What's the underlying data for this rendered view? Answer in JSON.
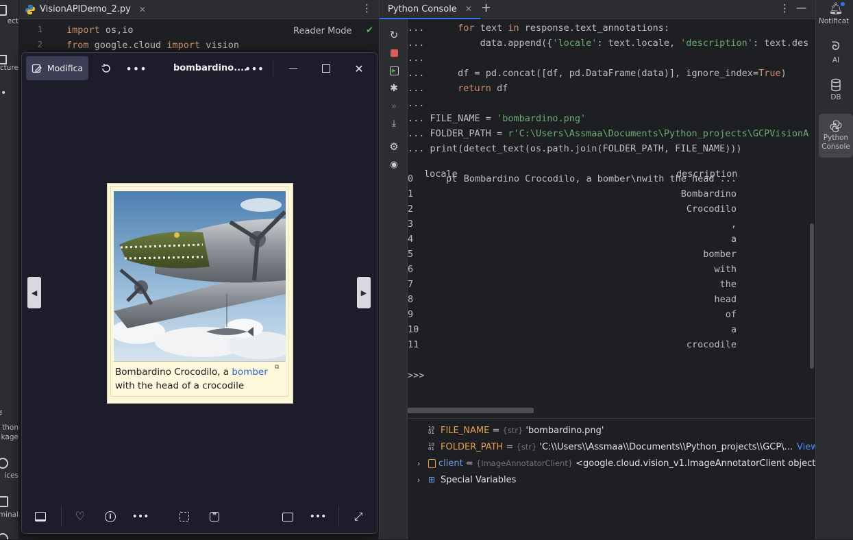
{
  "left_strip": {
    "labels": [
      "ect",
      "cture",
      "thon\nkage",
      "ices",
      "minal"
    ]
  },
  "editor": {
    "file_name": "VisionAPIDemo_2.py",
    "reader_mode": "Reader Mode",
    "lines": [
      {
        "num": "1",
        "kw1": "import",
        "rest": " os,io"
      },
      {
        "num": "2",
        "kw1": "from",
        "mid": " google.cloud ",
        "kw2": "import",
        "rest": " vision"
      }
    ]
  },
  "viewer": {
    "edit_label": "Modifica",
    "title": "bombardino....",
    "caption_text": "Bombardino Crocodilo, a ",
    "caption_link": "bomber",
    "caption_line2": "with the head of a crocodile",
    "accent": "#5b5fc7"
  },
  "console": {
    "tab_label": "Python Console",
    "lines": [
      {
        "prefix": "...",
        "code": "      for text in response.text_annotations:"
      },
      {
        "prefix": "...",
        "code": "          data.append({'locale': text.locale, 'description': text.descrip"
      },
      {
        "prefix": "...",
        "code": ""
      },
      {
        "prefix": "...",
        "code": "      df = pd.concat([df, pd.DataFrame(data)], ignore_index=True)"
      },
      {
        "prefix": "...",
        "code": "      return df"
      },
      {
        "prefix": "...",
        "code": ""
      },
      {
        "prefix": "...",
        "code": " FILE_NAME = 'bombardino.png'"
      },
      {
        "prefix": "...",
        "code": " FOLDER_PATH = r'C:\\Users\\Assmaa\\Documents\\Python_projects\\GCPVisionAPID"
      },
      {
        "prefix": "...",
        "code": " print(detect_text(os.path.join(FOLDER_PATH, FILE_NAME)))"
      }
    ],
    "table_header": {
      "locale": "locale",
      "description": "description"
    },
    "table_rows": [
      {
        "idx": "0",
        "locale": "pt",
        "description": "Bombardino Crocodilo, a bomber\\nwith the head ..."
      },
      {
        "idx": "1",
        "locale": "",
        "description": "Bombardino"
      },
      {
        "idx": "2",
        "locale": "",
        "description": "Crocodilo"
      },
      {
        "idx": "3",
        "locale": "",
        "description": ","
      },
      {
        "idx": "4",
        "locale": "",
        "description": "a"
      },
      {
        "idx": "5",
        "locale": "",
        "description": "bomber"
      },
      {
        "idx": "6",
        "locale": "",
        "description": "with"
      },
      {
        "idx": "7",
        "locale": "",
        "description": "the"
      },
      {
        "idx": "8",
        "locale": "",
        "description": "head"
      },
      {
        "idx": "9",
        "locale": "",
        "description": "of"
      },
      {
        "idx": "10",
        "locale": "",
        "description": "a"
      },
      {
        "idx": "11",
        "locale": "",
        "description": "crocodile"
      }
    ],
    "prompt": ">>>"
  },
  "variables": [
    {
      "icon": "string-var-icon",
      "name": "FILE_NAME",
      "type": "{str}",
      "value": "'bombardino.png'",
      "expandable": false
    },
    {
      "icon": "string-var-icon",
      "name": "FOLDER_PATH",
      "type": "{str}",
      "value": "'C:\\\\Users\\\\Assmaa\\\\Documents\\\\Python_projects\\\\GCP\\...",
      "link": "View",
      "expandable": false
    },
    {
      "icon": "object-var-icon",
      "name": "client",
      "type": "{ImageAnnotatorClient}",
      "value": "<google.cloud.vision_v1.ImageAnnotatorClient object",
      "expandable": true
    },
    {
      "icon": "special-vars-icon",
      "name": "Special Variables",
      "type": "",
      "value": "",
      "expandable": true
    }
  ],
  "right_strip": {
    "items": [
      "Notificat",
      "AI",
      "DB",
      "Python\nConsole"
    ]
  }
}
